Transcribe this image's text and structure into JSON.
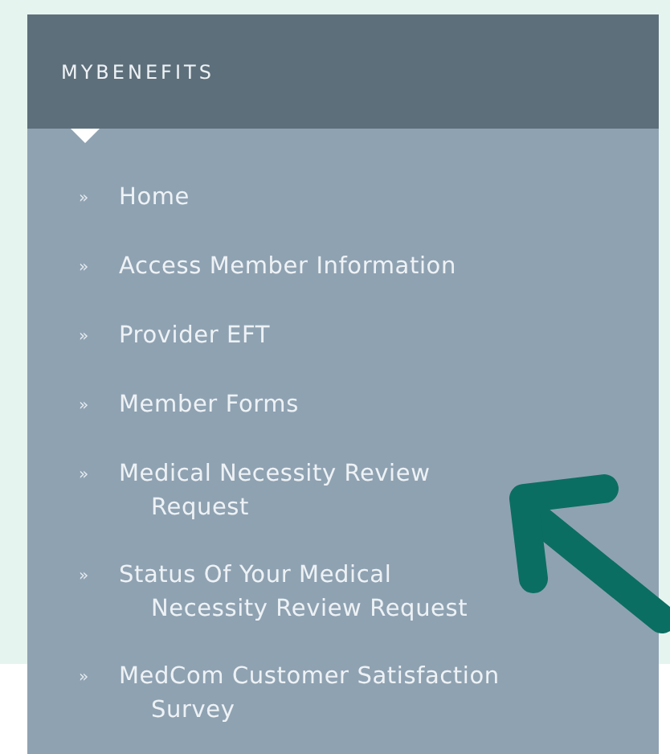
{
  "menu": {
    "title": "MYBENEFITS",
    "items": [
      {
        "bullet": "»",
        "lines": [
          "Home"
        ]
      },
      {
        "bullet": "»",
        "lines": [
          "Access Member Information"
        ]
      },
      {
        "bullet": "»",
        "lines": [
          "Provider EFT"
        ]
      },
      {
        "bullet": "»",
        "lines": [
          "Member Forms"
        ]
      },
      {
        "bullet": "»",
        "lines": [
          "Medical Necessity Review",
          "Request"
        ]
      },
      {
        "bullet": "»",
        "lines": [
          "Status Of Your Medical",
          "Necessity Review Request"
        ]
      },
      {
        "bullet": "»",
        "lines": [
          "MedCom Customer Satisfaction",
          "Survey"
        ]
      }
    ]
  }
}
